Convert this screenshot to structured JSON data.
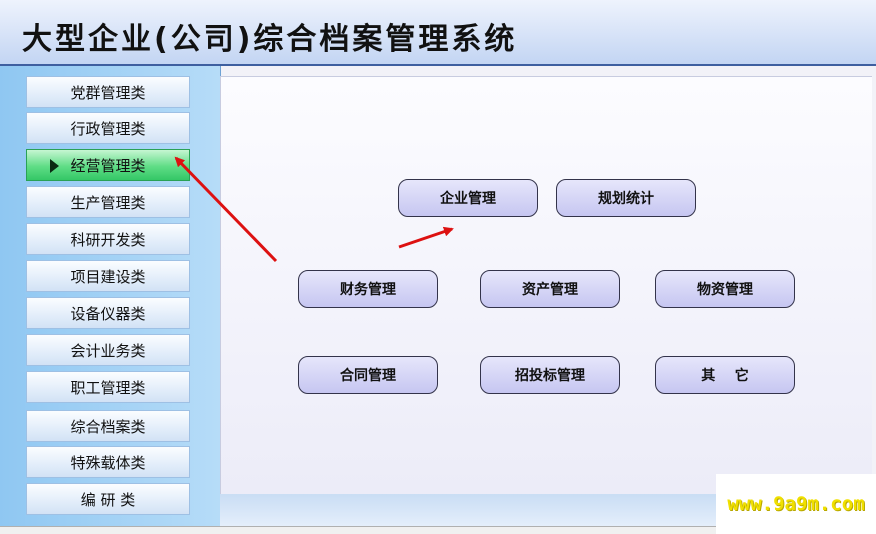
{
  "header": {
    "title": "大型企业(公司)综合档案管理系统"
  },
  "sidebar": {
    "items": [
      {
        "label": "党群管理类",
        "active": false
      },
      {
        "label": "行政管理类",
        "active": false
      },
      {
        "label": "经营管理类",
        "active": true
      },
      {
        "label": "生产管理类",
        "active": false
      },
      {
        "label": "科研开发类",
        "active": false
      },
      {
        "label": "项目建设类",
        "active": false
      },
      {
        "label": "设备仪器类",
        "active": false
      },
      {
        "label": "会计业务类",
        "active": false
      },
      {
        "label": "职工管理类",
        "active": false
      },
      {
        "label": "综合档案类",
        "active": false
      },
      {
        "label": "特殊载体类",
        "active": false
      },
      {
        "label": "编 研 类",
        "active": false
      }
    ]
  },
  "main": {
    "buttons": [
      {
        "label": "企业管理"
      },
      {
        "label": "规划统计"
      },
      {
        "label": "财务管理"
      },
      {
        "label": "资产管理"
      },
      {
        "label": "物资管理"
      },
      {
        "label": "合同管理"
      },
      {
        "label": "招投标管理"
      },
      {
        "label": "其    它"
      }
    ]
  },
  "watermark": {
    "text": "www.9a9m.com"
  },
  "colors": {
    "active_item": "#4fd27a",
    "arrow": "#dd1111",
    "header_border": "#3e5fa0"
  }
}
